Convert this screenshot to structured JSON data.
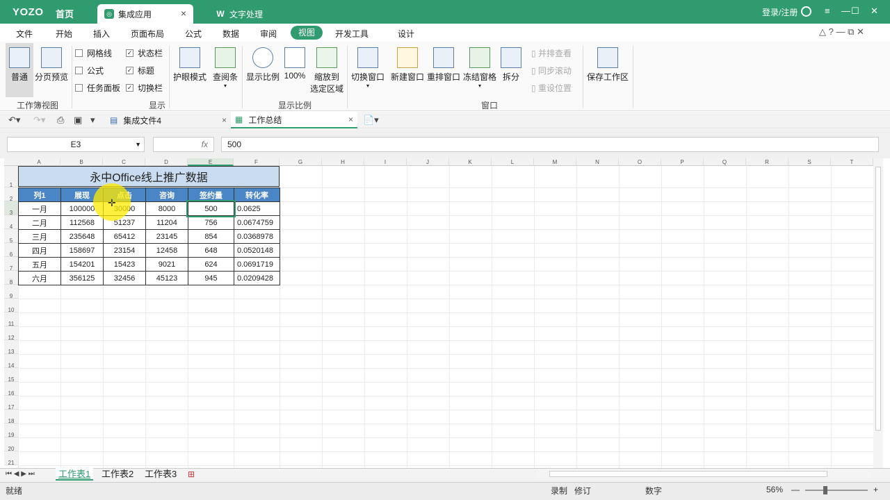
{
  "titlebar": {
    "logo": "YOZO",
    "home": "首页",
    "tabs": [
      {
        "label": "集成应用",
        "icon": "app-icon"
      },
      {
        "label": "文字处理",
        "icon": "word-icon"
      }
    ],
    "login": "登录/注册",
    "window_controls": [
      "≡",
      "—",
      "☐",
      "✕"
    ]
  },
  "menu": {
    "items": [
      "文件",
      "开始",
      "插入",
      "页面布局",
      "公式",
      "数据",
      "审阅",
      "视图",
      "开发工具",
      "设计"
    ],
    "active": "视图"
  },
  "ribbon": {
    "workbook_view": {
      "normal": "普通",
      "page_break": "分页预览",
      "group": "工作簿视图"
    },
    "show": {
      "gridlines": "网格线",
      "formula": "公式",
      "task_pane": "任务面板",
      "statusbar": "状态栏",
      "headings": "标题",
      "switch_bar": "切换栏",
      "group": "显示"
    },
    "eye_mode": "护眼模式",
    "read_bar": "查阅条",
    "zoom": {
      "display_ratio": "显示比例",
      "hundred": "100%",
      "zoom_to_line1": "缩放到",
      "zoom_to_line2": "选定区域",
      "group": "显示比例"
    },
    "window": {
      "switch": "切换窗口",
      "new": "新建窗口",
      "arrange": "重排窗口",
      "freeze": "冻结窗格",
      "split": "拆分",
      "side_by_side": "并排查看",
      "sync_scroll": "同步滚动",
      "reset_pos": "重设位置",
      "group": "窗口"
    },
    "save_workspace": "保存工作区"
  },
  "doc_tabs": [
    {
      "label": "集成文件4",
      "close": "×"
    },
    {
      "label": "工作总结",
      "close": "×"
    }
  ],
  "formula_bar": {
    "name_box": "E3",
    "fx": "fx",
    "value": "500"
  },
  "columns": [
    "A",
    "B",
    "C",
    "D",
    "E",
    "F",
    "G",
    "H",
    "I",
    "J",
    "K",
    "L",
    "M",
    "N",
    "O",
    "P",
    "Q",
    "R",
    "S",
    "T"
  ],
  "rows": [
    "1",
    "2",
    "3",
    "4",
    "5",
    "6",
    "7",
    "8",
    "9",
    "10",
    "11",
    "12",
    "13",
    "14",
    "15",
    "16",
    "17",
    "18",
    "19",
    "20",
    "21"
  ],
  "table": {
    "title": "永中Office线上推广数据",
    "headers": [
      "列1",
      "展现",
      "点击",
      "咨询",
      "签约量",
      "转化率"
    ],
    "data": [
      [
        "一月",
        "100000",
        "30000",
        "8000",
        "500",
        "0.0625"
      ],
      [
        "二月",
        "112568",
        "51237",
        "11204",
        "756",
        "0.0674759"
      ],
      [
        "三月",
        "235648",
        "65412",
        "23145",
        "854",
        "0.0368978"
      ],
      [
        "四月",
        "158697",
        "23154",
        "12458",
        "648",
        "0.0520148"
      ],
      [
        "五月",
        "154201",
        "15423",
        "9021",
        "624",
        "0.0691719"
      ],
      [
        "六月",
        "356125",
        "32456",
        "45123",
        "945",
        "0.0209428"
      ]
    ]
  },
  "sheets": {
    "tabs": [
      "工作表1",
      "工作表2",
      "工作表3"
    ],
    "active": "工作表1"
  },
  "status": {
    "ready": "就绪",
    "record": "录制",
    "revise": "修订",
    "num": "数字",
    "zoom": "56%",
    "minus": "—",
    "plus": "+"
  },
  "colors": {
    "brand": "#2f9b6e",
    "header_fill": "#4a86c6",
    "title_fill": "#c9dcf0",
    "highlight": "#ffeb00"
  }
}
